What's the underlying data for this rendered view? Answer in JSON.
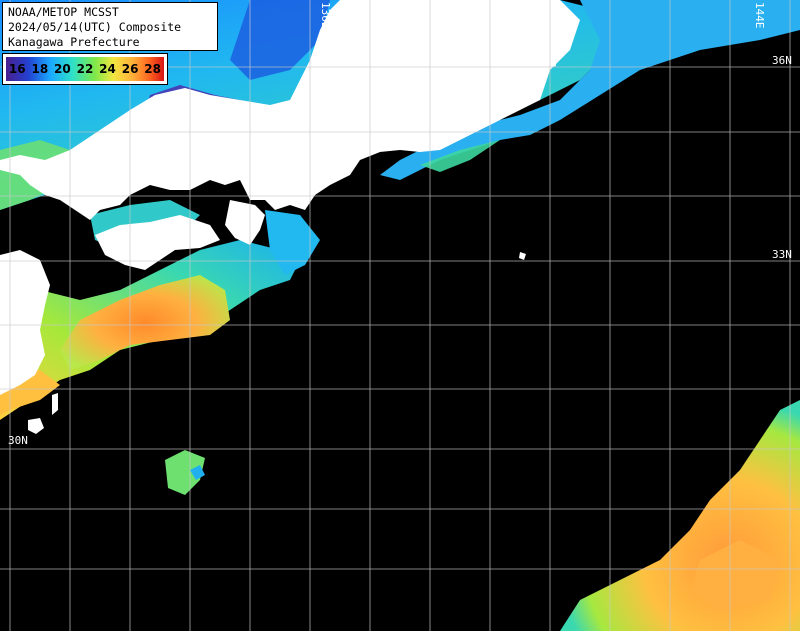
{
  "title": {
    "line1": "NOAA/METOP MCSST",
    "line2": "2024/05/14(UTC) Composite",
    "line3": "Kanagawa Prefecture"
  },
  "legend": {
    "ticks": [
      "16",
      "18",
      "20",
      "22",
      "24",
      "26",
      "28"
    ],
    "colors": [
      "#4a1f8f",
      "#2340d0",
      "#1aa8ff",
      "#2ee0c8",
      "#7de84a",
      "#f2e640",
      "#ffb13a",
      "#ff6a20",
      "#d81414"
    ]
  },
  "grid_labels": {
    "lon_136": "136E",
    "lon_144": "144E",
    "lat_36": "36N",
    "lat_33": "33N",
    "lat_30": "30N"
  },
  "colors": {
    "land": "#ffffff",
    "cloud": "#000000",
    "grid": "#bfbfbf"
  }
}
